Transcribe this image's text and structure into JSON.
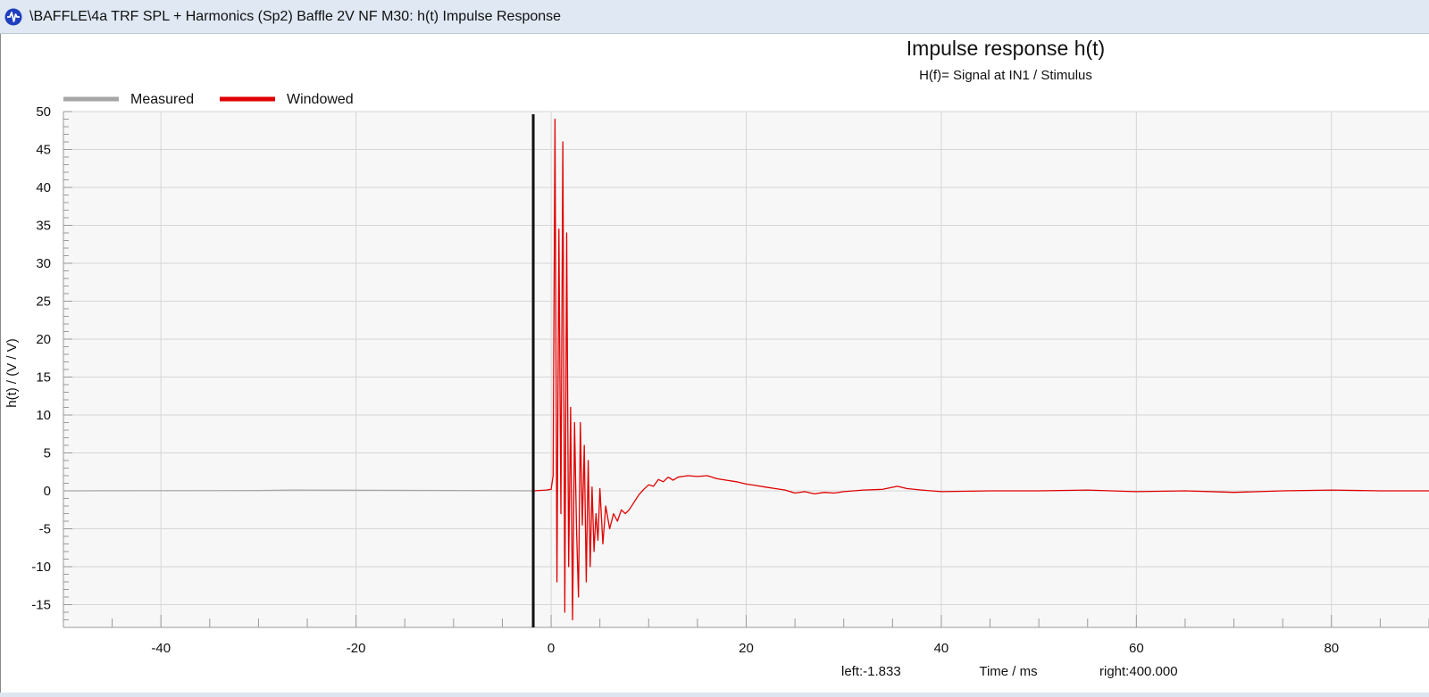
{
  "window": {
    "title": "\\BAFFLE\\4a TRF SPL + Harmonics (Sp2) Baffle 2V NF M30: h(t) Impulse Response",
    "icon": "waveform-icon",
    "accent": "#1f3fbf"
  },
  "chart_data": {
    "type": "line",
    "title": "Impulse response h(t)",
    "subtitle": "H(f)= Signal at IN1 / Stimulus",
    "xlabel": "Time / ms",
    "ylabel": "h(t) / (V / V)",
    "xlim": [
      -50,
      90
    ],
    "ylim": [
      -18,
      50
    ],
    "x_ticks": [
      -40,
      -20,
      0,
      20,
      40,
      60,
      80
    ],
    "y_ticks": [
      50,
      45,
      40,
      35,
      30,
      25,
      20,
      15,
      10,
      5,
      0,
      -5,
      -10,
      -15
    ],
    "grid": true,
    "legend_position": "top-left",
    "marker_line_x": -1.833,
    "footer": {
      "left_text": "left:-1.833",
      "right_text": "right:400.000"
    },
    "series": [
      {
        "name": "Measured",
        "color": "#a6a6a6",
        "x": [
          -50,
          -30,
          -26.5,
          -10,
          -1.833
        ],
        "y": [
          0,
          0.05,
          0.1,
          0.05,
          0
        ]
      },
      {
        "name": "Windowed",
        "color": "#e00000",
        "x": [
          -1.833,
          -0.5,
          0,
          0.2,
          0.4,
          0.6,
          0.8,
          1.0,
          1.2,
          1.4,
          1.6,
          1.8,
          2.0,
          2.2,
          2.4,
          2.6,
          2.8,
          3.0,
          3.2,
          3.4,
          3.6,
          3.8,
          4.0,
          4.2,
          4.4,
          4.6,
          4.8,
          5.0,
          5.3,
          5.6,
          6.0,
          6.4,
          6.8,
          7.2,
          7.6,
          8.0,
          8.5,
          9.0,
          9.5,
          10.0,
          10.5,
          11.0,
          11.5,
          12.0,
          12.5,
          13.0,
          14.0,
          15.0,
          16.0,
          17.0,
          18.0,
          19.0,
          20.0,
          21.0,
          22.0,
          23.0,
          24.0,
          25.0,
          26.0,
          27.0,
          28.0,
          29.0,
          30.0,
          32.0,
          34.0,
          35.5,
          36.5,
          38.0,
          40.0,
          45.0,
          50.0,
          55.0,
          60.0,
          65.0,
          70.0,
          75.0,
          80.0,
          85.0,
          90.0
        ],
        "y": [
          0,
          0.1,
          0.2,
          2.0,
          49.0,
          -12.0,
          34.5,
          -3.0,
          46.0,
          -16.0,
          34.0,
          -10.0,
          11.0,
          -17.0,
          9.0,
          -5.0,
          -14.0,
          9.0,
          -4.5,
          6.0,
          -12.0,
          4.0,
          -10.0,
          0.5,
          -8.0,
          -3.0,
          -6.5,
          0.3,
          -7.0,
          -2.0,
          -5.0,
          -3.0,
          -4.0,
          -2.5,
          -3.0,
          -2.5,
          -1.5,
          -0.5,
          0.2,
          0.8,
          0.6,
          1.5,
          1.2,
          1.8,
          1.4,
          1.8,
          2.0,
          1.9,
          2.0,
          1.6,
          1.4,
          1.2,
          0.9,
          0.7,
          0.5,
          0.3,
          0.1,
          -0.3,
          -0.1,
          -0.4,
          -0.2,
          -0.3,
          -0.1,
          0.1,
          0.2,
          0.6,
          0.3,
          0.1,
          -0.1,
          0.0,
          0.0,
          0.1,
          -0.1,
          0.0,
          -0.2,
          0.0,
          0.1,
          0.0,
          0.0
        ]
      }
    ]
  }
}
